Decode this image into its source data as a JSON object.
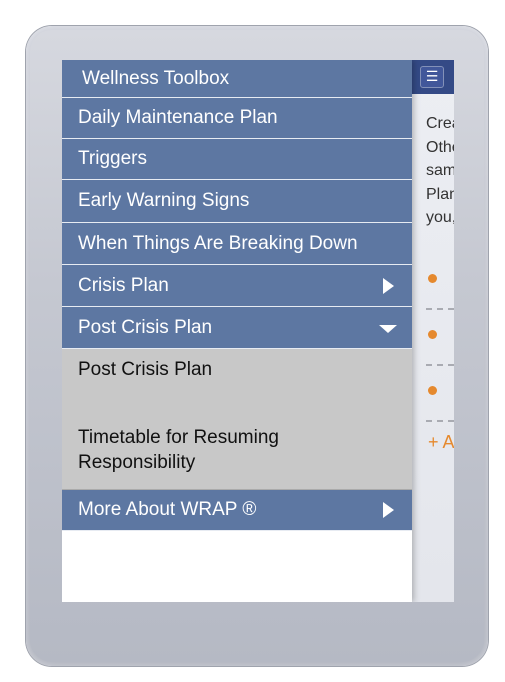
{
  "drawer": {
    "title": "Wellness Toolbox",
    "items": [
      {
        "label": "Daily Maintenance Plan"
      },
      {
        "label": "Triggers"
      },
      {
        "label": "Early Warning Signs"
      },
      {
        "label": "When Things Are Breaking Down"
      },
      {
        "label": "Crisis Plan"
      },
      {
        "label": "Post Crisis Plan"
      }
    ],
    "submenu": [
      {
        "label": "Post Crisis Plan"
      },
      {
        "label": "Timetable for Resuming Responsibility"
      }
    ],
    "more": {
      "label": "More About WRAP ®"
    }
  },
  "page": {
    "menu_icon": "hamburger-icon",
    "text_lines": [
      "Crea",
      "Othe",
      "sam",
      "Plan",
      "you,"
    ],
    "add_label": "+ A"
  },
  "colors": {
    "menu_item_bg": "#5d77a2",
    "submenu_bg": "#c8c8c8",
    "header_bg": "#344a86",
    "accent": "#e5892e"
  }
}
